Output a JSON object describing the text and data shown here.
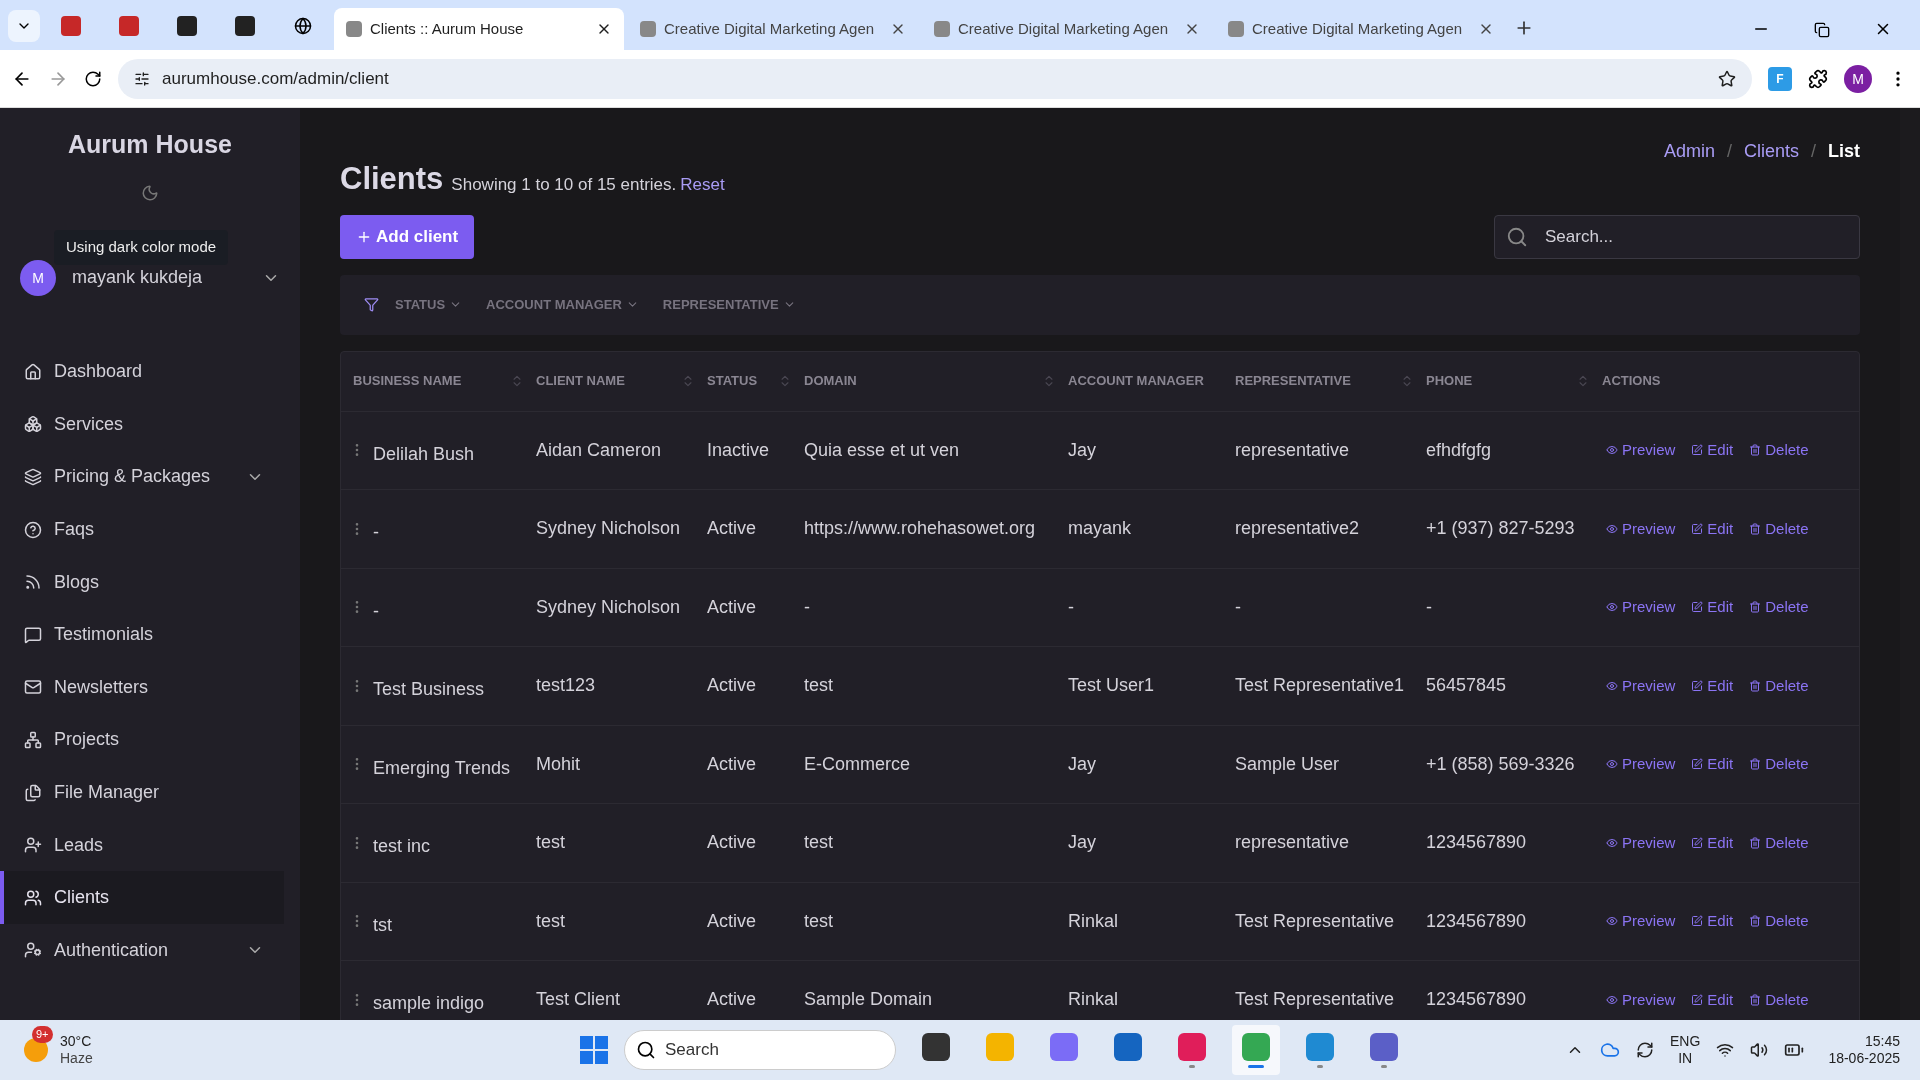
{
  "browser": {
    "pinned_tabs": [
      {
        "kind": "red"
      },
      {
        "kind": "red"
      },
      {
        "kind": "dark"
      },
      {
        "kind": "dark"
      },
      {
        "kind": "globe"
      }
    ],
    "tabs": [
      {
        "title": "Clients :: Aurum House",
        "selected": true
      },
      {
        "title": "Creative Digital Marketing Agen",
        "selected": false
      },
      {
        "title": "Creative Digital Marketing Agen",
        "selected": false
      },
      {
        "title": "Creative Digital Marketing Agen",
        "selected": false
      }
    ],
    "address": "aurumhouse.com/admin/client",
    "profile": "M",
    "extension": "F"
  },
  "sidebar": {
    "brand": "Aurum House",
    "tooltip": "Using dark color mode",
    "user": {
      "initial": "M",
      "name": "mayank kukdeja"
    },
    "items": [
      {
        "label": "Dashboard",
        "selected": false,
        "expandable": false
      },
      {
        "label": "Services",
        "selected": false,
        "expandable": false
      },
      {
        "label": "Pricing & Packages",
        "selected": false,
        "expandable": true
      },
      {
        "label": "Faqs",
        "selected": false,
        "expandable": false
      },
      {
        "label": "Blogs",
        "selected": false,
        "expandable": false
      },
      {
        "label": "Testimonials",
        "selected": false,
        "expandable": false
      },
      {
        "label": "Newsletters",
        "selected": false,
        "expandable": false
      },
      {
        "label": "Projects",
        "selected": false,
        "expandable": false
      },
      {
        "label": "File Manager",
        "selected": false,
        "expandable": false
      },
      {
        "label": "Leads",
        "selected": false,
        "expandable": false
      },
      {
        "label": "Clients",
        "selected": true,
        "expandable": false
      },
      {
        "label": "Authentication",
        "selected": false,
        "expandable": true
      }
    ]
  },
  "page": {
    "title": "Clients",
    "summary": "Showing 1 to 10 of 15 entries.",
    "reset": "Reset",
    "add_button": "Add client",
    "breadcrumb": [
      {
        "label": "Admin",
        "selected": false
      },
      {
        "label": "Clients",
        "selected": false
      },
      {
        "label": "List",
        "selected": true
      }
    ],
    "breadcrumb_separators": [
      "/",
      "/"
    ],
    "search": {
      "placeholder": "Search..."
    },
    "filters": [
      "STATUS",
      "ACCOUNT MANAGER",
      "REPRESENTATIVE"
    ],
    "table": {
      "columns": [
        {
          "label": "BUSINESS NAME",
          "sortable": true
        },
        {
          "label": "CLIENT NAME",
          "sortable": true
        },
        {
          "label": "STATUS",
          "sortable": true
        },
        {
          "label": "DOMAIN",
          "sortable": true
        },
        {
          "label": "ACCOUNT MANAGER",
          "sortable": false
        },
        {
          "label": "REPRESENTATIVE",
          "sortable": true
        },
        {
          "label": "PHONE",
          "sortable": true
        },
        {
          "label": "ACTIONS",
          "sortable": false
        }
      ],
      "rows": [
        {
          "cells": [
            "Delilah Bush",
            "Aidan Cameron",
            "Inactive",
            "Quia esse et ut ven",
            "Jay",
            "representative",
            "efhdfgfg"
          ],
          "actions": [
            "Preview",
            "Edit",
            "Delete"
          ]
        },
        {
          "cells": [
            "-",
            "Sydney Nicholson",
            "Active",
            "https://www.rohehasowet.org",
            "mayank",
            "representative2",
            "+1 (937) 827-5293"
          ],
          "actions": [
            "Preview",
            "Edit",
            "Delete"
          ]
        },
        {
          "cells": [
            "-",
            "Sydney Nicholson",
            "Active",
            "-",
            "-",
            "-",
            "-"
          ],
          "actions": [
            "Preview",
            "Edit",
            "Delete"
          ]
        },
        {
          "cells": [
            "Test Business",
            "test123",
            "Active",
            "test",
            "Test User1",
            "Test Representative1",
            "56457845"
          ],
          "actions": [
            "Preview",
            "Edit",
            "Delete"
          ]
        },
        {
          "cells": [
            "Emerging Trends",
            "Mohit",
            "Active",
            "E-Commerce",
            "Jay",
            "Sample User",
            "+1 (858) 569-3326"
          ],
          "actions": [
            "Preview",
            "Edit",
            "Delete"
          ]
        },
        {
          "cells": [
            "test inc",
            "test",
            "Active",
            "test",
            "Jay",
            "representative",
            "1234567890"
          ],
          "actions": [
            "Preview",
            "Edit",
            "Delete"
          ]
        },
        {
          "cells": [
            "tst",
            "test",
            "Active",
            "test",
            "Rinkal",
            "Test Representative",
            "1234567890"
          ],
          "actions": [
            "Preview",
            "Edit",
            "Delete"
          ]
        },
        {
          "cells": [
            "sample indigo",
            "Test Client",
            "Active",
            "Sample Domain",
            "Rinkal",
            "Test Representative",
            "1234567890"
          ],
          "actions": [
            "Preview",
            "Edit",
            "Delete"
          ]
        }
      ]
    }
  },
  "taskbar": {
    "weather": {
      "badge": "9+",
      "temperature": "30°C",
      "condition": "Haze"
    },
    "search": {
      "placeholder": "Search"
    },
    "apps": [
      {
        "kind": "files-dark",
        "selected": false,
        "running": false
      },
      {
        "kind": "folder",
        "selected": false,
        "running": false
      },
      {
        "kind": "copilot",
        "selected": false,
        "running": false
      },
      {
        "kind": "store",
        "selected": false,
        "running": false
      },
      {
        "kind": "slack",
        "selected": false,
        "running": true
      },
      {
        "kind": "chrome",
        "selected": true,
        "running": true
      },
      {
        "kind": "vscode",
        "selected": false,
        "running": true
      },
      {
        "kind": "teams",
        "selected": false,
        "running": true
      }
    ],
    "language": [
      "ENG",
      "IN"
    ],
    "time": "15:45",
    "date": "18-06-2025"
  }
}
